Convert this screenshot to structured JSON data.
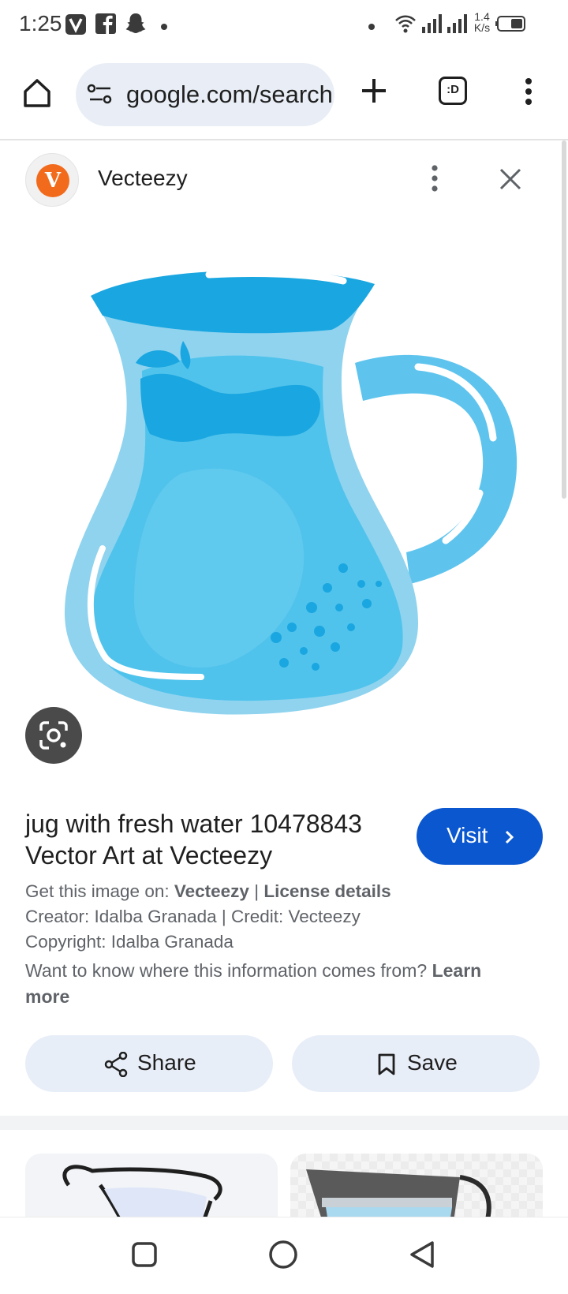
{
  "status_bar": {
    "time": "1:25",
    "net_speed_value": "1.4",
    "net_speed_unit": "K/s",
    "icons": [
      "vpn-v-icon",
      "facebook-icon",
      "snapchat-icon",
      "dot-icon",
      "wifi-icon",
      "signal-icon",
      "signal-icon",
      "battery-icon"
    ]
  },
  "browser": {
    "url": "google.com/search",
    "tab_count_label": ":D",
    "icons": [
      "home-icon",
      "site-info-icon",
      "new-tab-plus-icon",
      "tab-switcher-icon",
      "overflow-menu-icon"
    ]
  },
  "source": {
    "logo_letter": "V",
    "name": "Vecteezy"
  },
  "image": {
    "subject": "jug-with-water-illustration",
    "colors": {
      "light": "#8fd3ef",
      "mid": "#4fc3ec",
      "dark": "#1aa6e0",
      "handle": "#5ec4ee"
    }
  },
  "result": {
    "title": "jug with fresh water 10478843 Vector Art at Vecteezy",
    "visit_label": "Visit",
    "get_image_prefix": "Get this image on:",
    "get_image_source": "Vecteezy",
    "separator": "|",
    "license_label": "License details",
    "creator_line": "Creator: Idalba Granada | Credit: Vecteezy",
    "copyright_line": "Copyright: Idalba Granada",
    "info_question": "Want to know where this information comes from?",
    "learn_more": "Learn more"
  },
  "actions": {
    "share_label": "Share",
    "save_label": "Save"
  },
  "nav": {
    "icons": [
      "recent-apps-icon",
      "home-circle-icon",
      "back-icon"
    ]
  },
  "colors": {
    "accent": "#0b57d0",
    "pill_bg": "#e8eef8",
    "secondary_text": "#5f6368"
  }
}
